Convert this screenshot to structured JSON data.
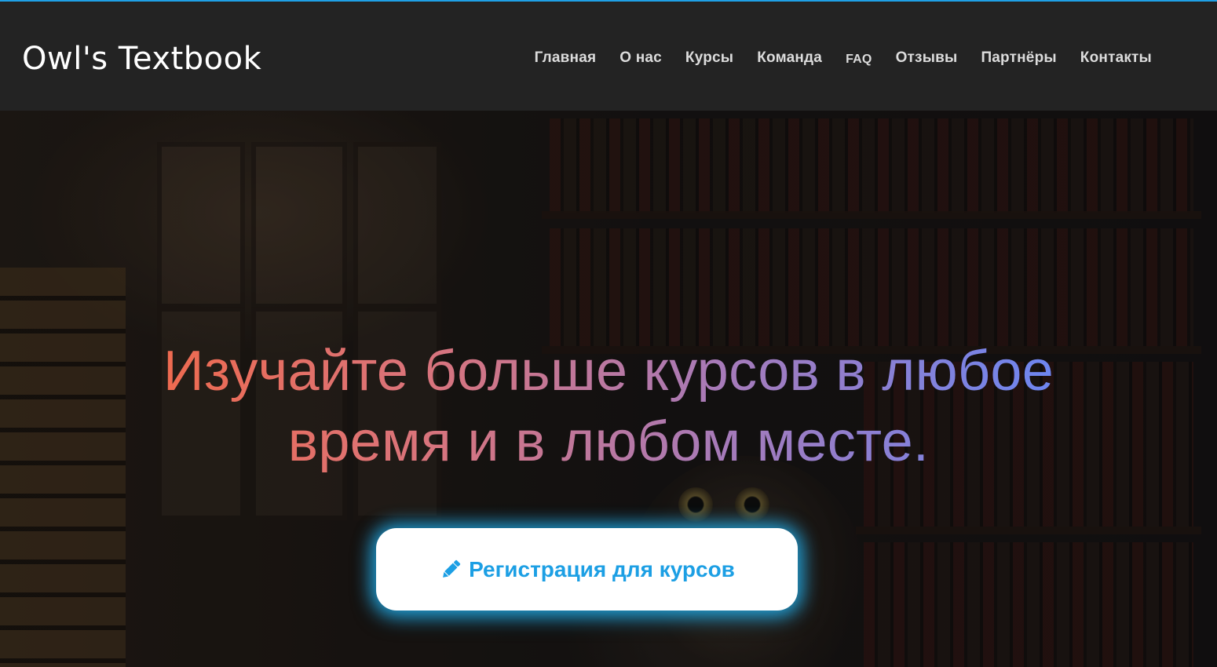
{
  "header": {
    "logo": "Owl's Textbook",
    "nav": [
      {
        "label": "Главная"
      },
      {
        "label": "О нас"
      },
      {
        "label": "Курсы"
      },
      {
        "label": "Команда"
      },
      {
        "label": "FAQ"
      },
      {
        "label": "Отзывы"
      },
      {
        "label": "Партнёры"
      },
      {
        "label": "Контакты"
      }
    ]
  },
  "hero": {
    "title": "Изучайте больше курсов в любое время и в любом месте.",
    "cta_label": "Регистрация для курсов",
    "cta_icon": "pencil-icon",
    "background_image": "owl-library-photo"
  },
  "colors": {
    "header_bg": "#232323",
    "accent": "#1c9fe4",
    "title_gradient": [
      "#ef6a4e",
      "#d9747c",
      "#a77ab8",
      "#6c86f2"
    ]
  }
}
